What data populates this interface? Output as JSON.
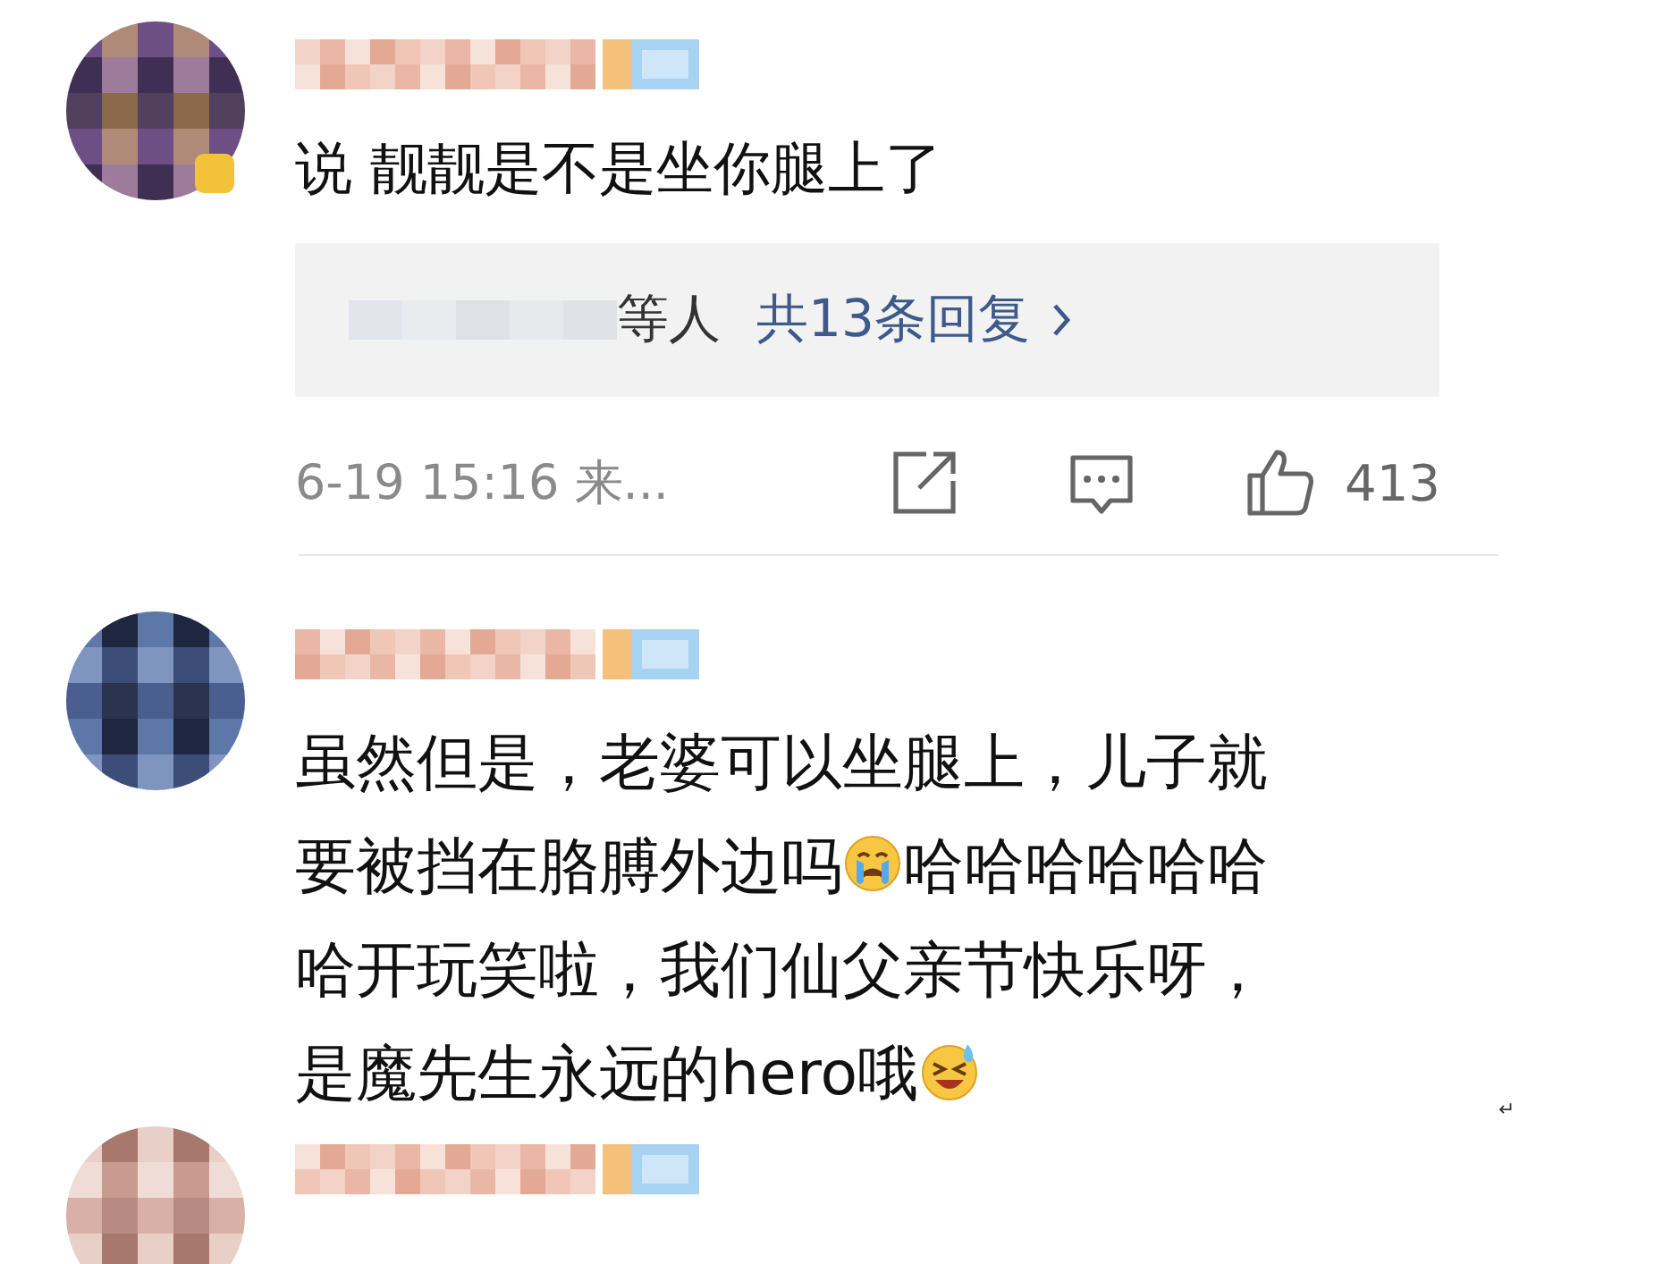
{
  "comments": [
    {
      "author": {
        "kind": "redacted"
      },
      "avatar": {
        "badge": true
      },
      "lines": [
        [
          {
            "kind": "text",
            "text": "说 靓靓是不是坐你腿上了"
          }
        ]
      ],
      "replies": {
        "suffix": "等人",
        "link": "共13条回复"
      },
      "footer": {
        "time": "6-19 15:16 来...",
        "likes": "413"
      }
    },
    {
      "author": {
        "kind": "redacted"
      },
      "avatar": {
        "badge": false
      },
      "lines": [
        [
          {
            "kind": "text",
            "text": "虽然但是，老婆可以坐腿上，儿子就"
          }
        ],
        [
          {
            "kind": "text",
            "text": "要被挡在胳膊外边吗"
          },
          {
            "kind": "crying_emoji"
          },
          {
            "kind": "text",
            "text": "哈哈哈哈哈哈"
          }
        ],
        [
          {
            "kind": "text",
            "text": "哈开玩笑啦，我们仙父亲节快乐呀，"
          }
        ],
        [
          {
            "kind": "text",
            "text": "是魔先生永远的hero哦"
          },
          {
            "kind": "laughing_emoji"
          }
        ]
      ],
      "mark": "↵"
    },
    {
      "author": {
        "kind": "redacted"
      },
      "avatar": {
        "badge": false
      }
    }
  ]
}
